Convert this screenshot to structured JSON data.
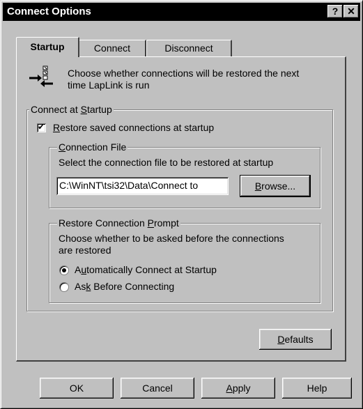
{
  "window": {
    "title": "Connect Options",
    "help_glyph": "?",
    "close_glyph": "✕"
  },
  "tabs": [
    {
      "label": "Startup",
      "active": true
    },
    {
      "label": "Connect",
      "active": false
    },
    {
      "label": "Disconnect",
      "active": false
    }
  ],
  "intro": {
    "icon": "connection-settings-icon",
    "line1": "Choose whether connections will be restored the next",
    "line2": "time LapLink is run"
  },
  "connect_at_startup": {
    "legend_pre": "Connect at ",
    "legend_ul": "S",
    "legend_post": "tartup",
    "restore_checkbox": {
      "checked": true,
      "label_ul": "R",
      "label_post": "estore saved connections at startup"
    },
    "connection_file": {
      "legend_ul": "C",
      "legend_post": "onnection File",
      "description": "Select the connection file to be restored at startup",
      "path_value": "C:\\WinNT\\tsi32\\Data\\Connect to",
      "browse_ul": "B",
      "browse_post": "rowse..."
    },
    "restore_prompt": {
      "legend_pre": "Restore Connection ",
      "legend_ul": "P",
      "legend_post": "rompt",
      "description_line1": "Choose whether to be asked before the connections",
      "description_line2": "are restored",
      "options": [
        {
          "pre": "A",
          "ul": "u",
          "post": "tomatically Connect at Startup",
          "selected": true
        },
        {
          "pre": "As",
          "ul": "k",
          "post": " Before Connecting",
          "selected": false
        }
      ]
    }
  },
  "defaults_button": {
    "ul": "D",
    "post": "efaults"
  },
  "footer_buttons": {
    "ok": "OK",
    "cancel": "Cancel",
    "apply_ul": "A",
    "apply_post": "pply",
    "help": "Help"
  }
}
